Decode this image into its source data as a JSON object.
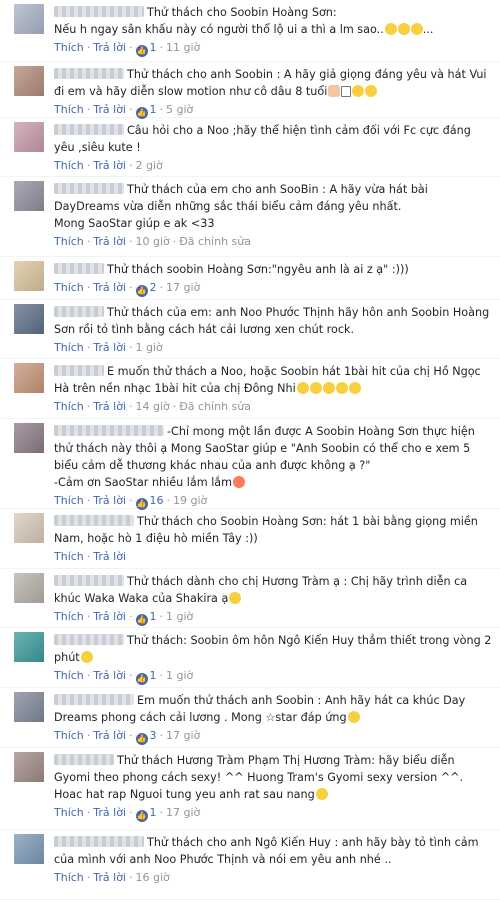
{
  "actions": {
    "like": "Thích",
    "reply": "Trả lời",
    "edited": "Đã chỉnh sửa"
  },
  "comments": [
    {
      "name_blur": 90,
      "text": "Thử thách cho Soobin Hoàng Sơn:\nNếu h ngay sân khấu này có người thổ lộ ui a thì a lm sao..",
      "emojis": [
        "grin",
        "grin",
        "grin"
      ],
      "tail": "...",
      "likes": "1",
      "time": "11 giờ",
      "edited": false,
      "avatar_color": "#a9b3c7",
      "height": 62
    },
    {
      "name_blur": 70,
      "text": "Thử thách cho anh Soobin : A hãy giả giọng đáng yêu và hát Vui đi em và hãy diễn slow motion như cô dâu 8 tuổi",
      "emojis": [
        "hand",
        "blank",
        "grin",
        "grin"
      ],
      "tail": "",
      "likes": "1",
      "time": "5 giờ",
      "edited": false,
      "avatar_color": "#b28a7a",
      "height": 56
    },
    {
      "name_blur": 70,
      "text": "Câu hỏi cho a Noo ;hãy thể hiện tình cảm đối với Fc cực đáng yêu ,siêu kute !",
      "emojis": [],
      "tail": "",
      "likes": "",
      "time": "2 giờ",
      "edited": false,
      "avatar_color": "#c79aa7",
      "height": 59
    },
    {
      "name_blur": 70,
      "text": "Thử thách của em cho anh SooBin : A hãy vừa hát bài DayDreams vừa diễn những sắc thái biểu cảm đáng yêu nhất.\nMong SaoStar giúp e ak <33",
      "emojis": [],
      "tail": "",
      "likes": "",
      "time": "10 giờ",
      "edited": true,
      "avatar_color": "#8f8f9e",
      "height": 80
    },
    {
      "name_blur": 50,
      "text": "Thử thách soobin Hoàng Sơn:\"ngyêu anh là ai z ạ\" :)))",
      "emojis": [],
      "tail": "",
      "likes": "2",
      "time": "17 giờ",
      "edited": false,
      "avatar_color": "#d9c39d",
      "height": 43
    },
    {
      "name_blur": 50,
      "text": "Thử thách của em: anh Noo Phước Thịnh hãy hôn anh Soobin Hoàng Sơn rồi tỏ tình bằng cách hát cải lương xen chút rock.",
      "emojis": [],
      "tail": "",
      "likes": "",
      "time": "1 giờ",
      "edited": false,
      "avatar_color": "#5e6f88",
      "height": 59
    },
    {
      "name_blur": 50,
      "text": "E muốn thử thách a Noo, hoặc Soobin hát 1bài hit của chị Hồ Ngọc Hà trên nền nhạc 1bài hit của chị Đông Nhi",
      "emojis": [
        "grin",
        "grin",
        "grin",
        "grin",
        "grin"
      ],
      "tail": "",
      "likes": "",
      "time": "14 giờ",
      "edited": true,
      "avatar_color": "#c79478",
      "height": 60
    },
    {
      "name_blur": 110,
      "text": "-Chỉ mong một lần được A Soobin Hoàng Sơn thực hiện thử thách này thôi ạ Mong SaoStar giúp e \"Anh Soobin có thể cho e xem 5 biểu cảm dễ thương khác nhau của anh được không ạ ?\"\n-Cảm ơn SaoStar nhiều lắm lắm",
      "emojis": [
        "love"
      ],
      "tail": "",
      "likes": "16",
      "time": "19 giờ",
      "edited": false,
      "avatar_color": "#8c7a86",
      "height": 90
    },
    {
      "name_blur": 80,
      "text": "Thử thách cho Soobin Hoàng Sơn: hát 1 bài bằng giọng miền Nam, hoặc hò 1 điệu hò miền Tây :))",
      "emojis": [],
      "tail": "",
      "likes": "",
      "time": "",
      "edited": false,
      "avatar_color": "#d8c9b8",
      "height": 60
    },
    {
      "name_blur": 70,
      "text": "Thử thách dành cho chị Hương Tràm ạ : Chị hãy trình diễn ca khúc Waka Waka của Shakira ạ",
      "emojis": [
        "grin"
      ],
      "tail": "",
      "likes": "1",
      "time": "1 giờ",
      "edited": false,
      "avatar_color": "#b7b0a8",
      "height": 59
    },
    {
      "name_blur": 70,
      "text": "Thử thách: Soobin ôm hôn Ngô Kiến Huy thắm thiết trong vòng 2 phút",
      "emojis": [
        "grin"
      ],
      "tail": "",
      "likes": "1",
      "time": "1 giờ",
      "edited": false,
      "avatar_color": "#3a9b9a",
      "height": 60
    },
    {
      "name_blur": 80,
      "text": "Em muốn thử thách anh Soobin : Anh hãy hát ca khúc Day Dreams phong cách cải lương . Mong ☆star đáp ứng",
      "emojis": [
        "grin"
      ],
      "tail": "",
      "likes": "3",
      "time": "17 giờ",
      "edited": false,
      "avatar_color": "#7f8797",
      "height": 60
    },
    {
      "name_blur": 60,
      "text": "Thử thách Hương Tràm Phạm Thị Hương Tràm: hãy biểu diễn Gyomi theo phong cách sexy! ^^ Huong Tram's Gyomi sexy version ^^. Hoac hat rap Nguoi tung yeu anh rat sau nang",
      "emojis": [
        "grin"
      ],
      "tail": "",
      "likes": "1",
      "time": "17 giờ",
      "edited": false,
      "avatar_color": "#a08a84",
      "height": 82
    },
    {
      "name_blur": 90,
      "text": "Thử thách cho anh Ngô Kiến Huy : anh hãy bày tỏ tình cảm của mình với anh Noo Phước Thịnh và nói em yêu anh nhé ..",
      "emojis": [],
      "tail": "",
      "likes": "",
      "time": "16 giờ",
      "edited": false,
      "avatar_color": "#7b98b6",
      "height": 70
    }
  ]
}
